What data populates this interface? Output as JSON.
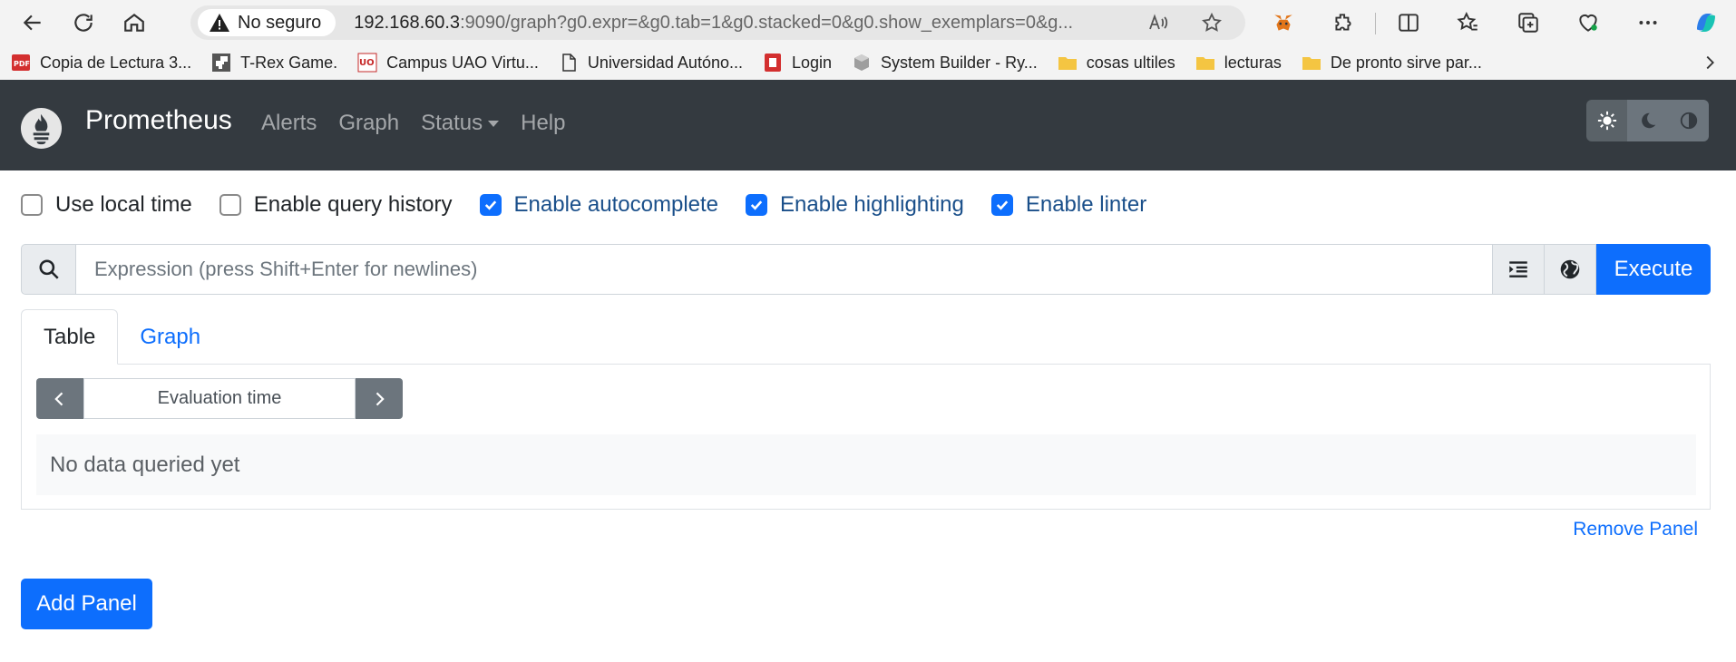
{
  "browser": {
    "security_label": "No seguro",
    "url_host": "192.168.60.3",
    "url_rest": ":9090/graph?g0.expr=&g0.tab=1&g0.stacked=0&g0.show_exemplars=0&g...",
    "bookmarks": [
      {
        "label": "Copia de Lectura 3...",
        "icon": "pdf-icon"
      },
      {
        "label": "T-Rex Game.",
        "icon": "trex-icon"
      },
      {
        "label": "Campus UAO Virtu...",
        "icon": "uao-icon"
      },
      {
        "label": "Universidad Autóno...",
        "icon": "page-icon"
      },
      {
        "label": "Login",
        "icon": "login-icon"
      },
      {
        "label": "System Builder - Ry...",
        "icon": "cube-icon"
      },
      {
        "label": "cosas ultiles",
        "icon": "folder-icon"
      },
      {
        "label": "lecturas",
        "icon": "folder-icon"
      },
      {
        "label": "De pronto sirve par...",
        "icon": "folder-icon"
      }
    ]
  },
  "app": {
    "brand": "Prometheus",
    "nav": {
      "alerts": "Alerts",
      "graph": "Graph",
      "status": "Status",
      "help": "Help"
    }
  },
  "options": {
    "local_time": "Use local time",
    "query_history": "Enable query history",
    "autocomplete": "Enable autocomplete",
    "highlighting": "Enable highlighting",
    "linter": "Enable linter"
  },
  "expression": {
    "placeholder": "Expression (press Shift+Enter for newlines)",
    "execute_label": "Execute"
  },
  "panel": {
    "tabs": [
      "Table",
      "Graph"
    ],
    "eval_placeholder": "Evaluation time",
    "no_data": "No data queried yet",
    "remove_label": "Remove Panel"
  },
  "add_panel_label": "Add Panel",
  "colors": {
    "accent": "#0d6efd",
    "navbar": "#343a40"
  }
}
